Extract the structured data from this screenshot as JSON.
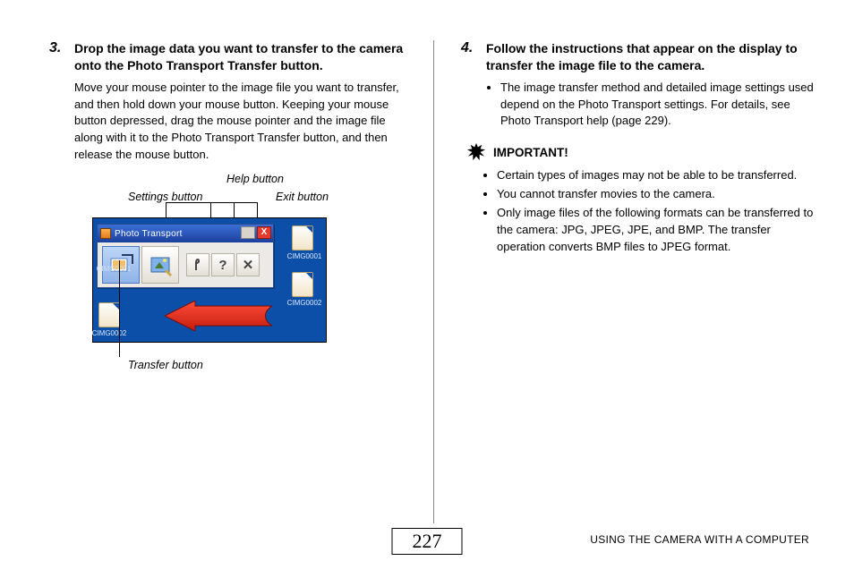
{
  "left": {
    "step_num": "3.",
    "step_title": "Drop the image data you want to transfer to the camera onto the Photo Transport Transfer button.",
    "step_body": "Move your mouse pointer to the image file you want to transfer, and then hold down your mouse button. Keeping your mouse button depressed, drag the mouse pointer and the image file along with it to the Photo Transport Transfer button, and then release the mouse button.",
    "callouts": {
      "settings": "Settings button",
      "help": "Help button",
      "exit": "Exit button",
      "transfer": "Transfer button"
    },
    "app_title": "Photo Transport",
    "thumb1": "CIMG0001",
    "thumb2": "CIMG0002",
    "thumb3": "CIMG0001",
    "thumb4": "CIMG0002"
  },
  "right": {
    "step_num": "4.",
    "step_title": "Follow the instructions that appear on the display to transfer the image file to the camera.",
    "bullet1": "The image transfer method and detailed image settings used depend on the Photo Transport settings. For details, see Photo Transport help (page 229).",
    "important": "IMPORTANT!",
    "imp_b1": "Certain types of images may not be able to be transferred.",
    "imp_b2": "You cannot transfer movies to the camera.",
    "imp_b3": "Only image files of the following formats can be transferred to the camera: JPG, JPEG, JPE, and BMP. The transfer operation converts BMP files to JPEG format."
  },
  "footer": {
    "page": "227",
    "section": "USING THE CAMERA WITH A COMPUTER"
  }
}
